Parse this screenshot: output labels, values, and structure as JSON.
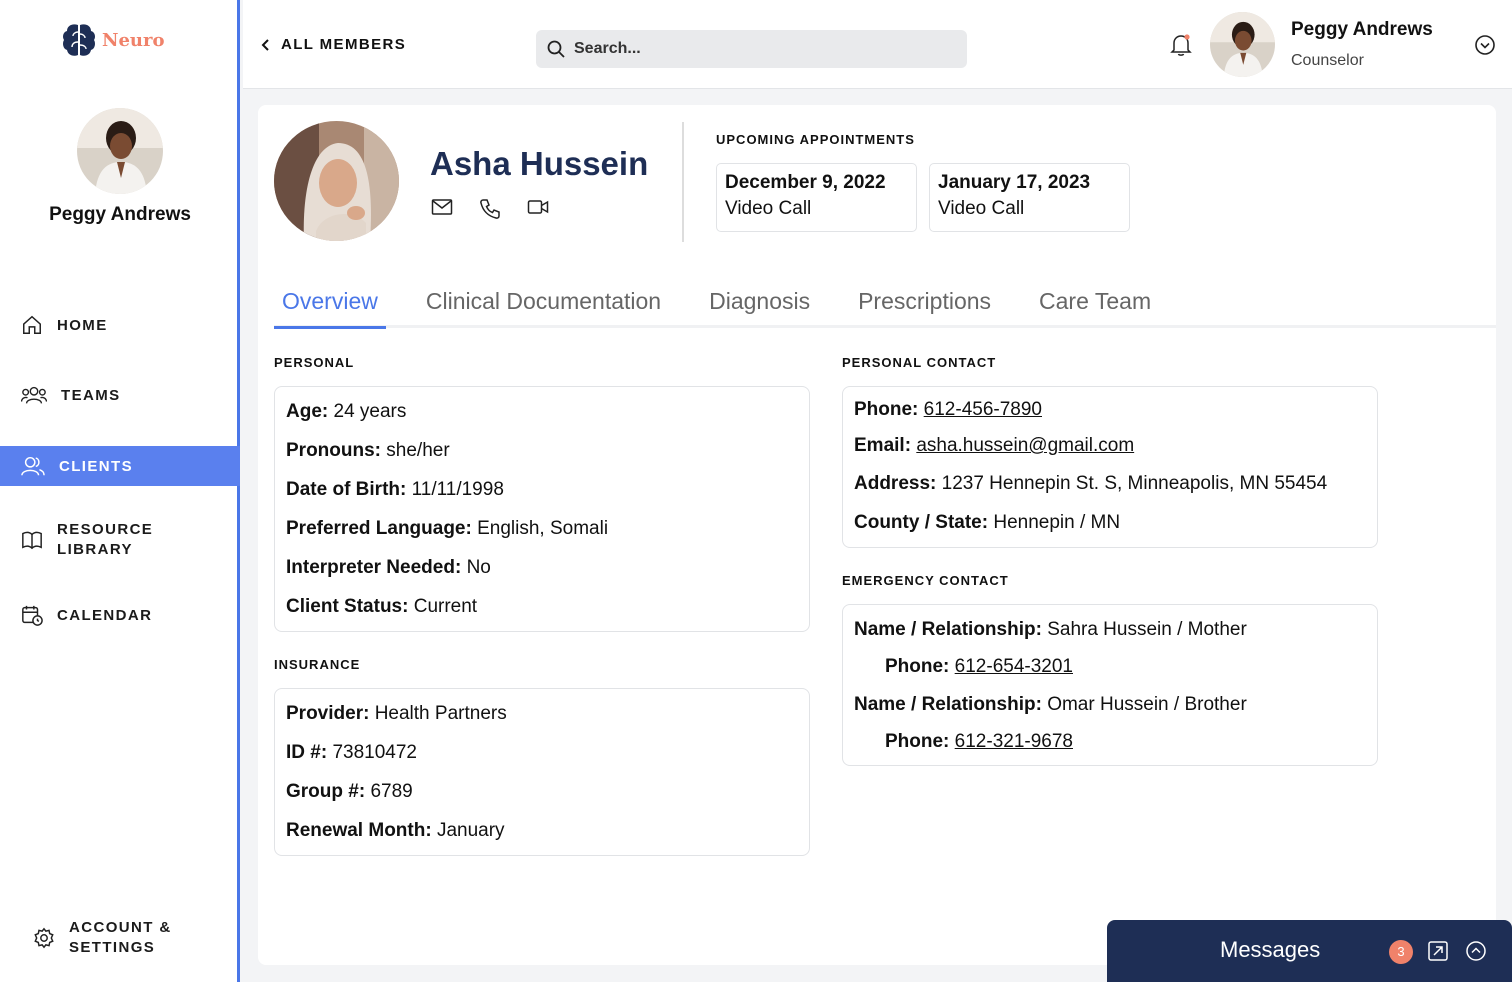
{
  "brand": {
    "name": "Neuro",
    "color": "#f0826a",
    "logo_icon": "brain-icon"
  },
  "sidebar": {
    "user_name": "Peggy Andrews",
    "nav": [
      {
        "label": "HOME",
        "icon": "home-icon"
      },
      {
        "label": "TEAMS",
        "icon": "teams-icon"
      },
      {
        "label": "CLIENTS",
        "icon": "clients-icon",
        "active": true
      },
      {
        "label_line1": "RESOURCE",
        "label_line2": "LIBRARY",
        "icon": "book-icon"
      },
      {
        "label": "CALENDAR",
        "icon": "calendar-icon"
      }
    ],
    "settings_line1": "ACCOUNT &",
    "settings_line2": "SETTINGS",
    "accent": "#5a80ee"
  },
  "header": {
    "back_label": "ALL MEMBERS",
    "search_placeholder": "Search...",
    "user_name": "Peggy Andrews",
    "user_role": "Counselor"
  },
  "client": {
    "name": "Asha Hussein",
    "contact_icons": [
      "mail-icon",
      "phone-icon",
      "video-icon"
    ]
  },
  "appointments": {
    "title": "UPCOMING APPOINTMENTS",
    "items": [
      {
        "date": "December 9, 2022",
        "type": "Video Call"
      },
      {
        "date": "January 17, 2023",
        "type": "Video Call"
      }
    ]
  },
  "tabs": [
    "Overview",
    "Clinical Documentation",
    "Diagnosis",
    "Prescriptions",
    "Care Team"
  ],
  "personal": {
    "title": "PERSONAL",
    "rows": [
      {
        "k": "Age:",
        "v": "24 years"
      },
      {
        "k": "Pronouns:",
        "v": "she/her"
      },
      {
        "k": "Date of Birth:",
        "v": "11/11/1998"
      },
      {
        "k": "Preferred Language:",
        "v": "English, Somali"
      },
      {
        "k": "Interpreter Needed:",
        "v": "No"
      },
      {
        "k": "Client Status:",
        "v": "Current"
      }
    ]
  },
  "insurance": {
    "title": "INSURANCE",
    "rows": [
      {
        "k": "Provider:",
        "v": "Health Partners"
      },
      {
        "k": "ID #:",
        "v": "73810472"
      },
      {
        "k": "Group #:",
        "v": "6789"
      },
      {
        "k": "Renewal Month:",
        "v": "January"
      }
    ]
  },
  "personal_contact": {
    "title": "PERSONAL CONTACT",
    "phone_k": "Phone:",
    "phone_v": "612-456-7890",
    "email_k": "Email:",
    "email_v": "asha.hussein@gmail.com",
    "address_k": "Address:",
    "address_v": "1237 Hennepin St. S, Minneapolis, MN 55454",
    "county_k": "County / State:",
    "county_v": "Hennepin / MN"
  },
  "emergency_contact": {
    "title": "EMERGENCY CONTACT",
    "contacts": [
      {
        "name_k": "Name / Relationship:",
        "name_v": "Sahra Hussein / Mother",
        "phone_k": "Phone:",
        "phone_v": "612-654-3201"
      },
      {
        "name_k": "Name / Relationship:",
        "name_v": "Omar Hussein / Brother",
        "phone_k": "Phone:",
        "phone_v": "612-321-9678"
      }
    ]
  },
  "messages": {
    "label": "Messages",
    "count": "3",
    "bar_color": "#1e2e55"
  }
}
